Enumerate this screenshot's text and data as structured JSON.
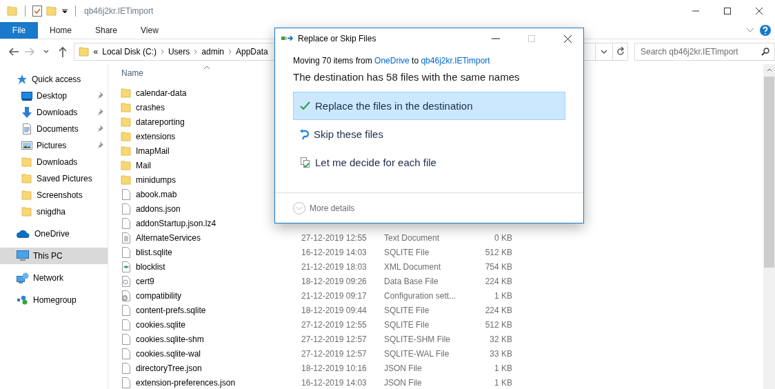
{
  "window": {
    "title": "qb46j2kr.IETimport"
  },
  "ribbon_tabs": [
    {
      "label": "File",
      "kind": "file"
    },
    {
      "label": "Home",
      "kind": "tab"
    },
    {
      "label": "Share",
      "kind": "tab"
    },
    {
      "label": "View",
      "kind": "tab"
    }
  ],
  "address_bar": {
    "overflow": "«",
    "segments": [
      "Local Disk (C:)",
      "Users",
      "admin",
      "AppData"
    ]
  },
  "search": {
    "placeholder": "Search qb46j2kr.IETimport"
  },
  "navigation": [
    {
      "label": "Quick access",
      "kind": "star",
      "selected": false,
      "children": [
        {
          "label": "Desktop",
          "kind": "desktop",
          "pinned": true,
          "selected": false
        },
        {
          "label": "Downloads",
          "kind": "download",
          "pinned": true,
          "selected": false
        },
        {
          "label": "Documents",
          "kind": "document",
          "pinned": true,
          "selected": false
        },
        {
          "label": "Pictures",
          "kind": "pictures",
          "pinned": true,
          "selected": false
        },
        {
          "label": "Downloads",
          "kind": "folder",
          "pinned": false,
          "selected": false
        },
        {
          "label": "Saved Pictures",
          "kind": "folder",
          "pinned": false,
          "selected": false
        },
        {
          "label": "Screenshots",
          "kind": "folder",
          "pinned": false,
          "selected": false
        },
        {
          "label": "snigdha",
          "kind": "folder",
          "pinned": false,
          "selected": false
        }
      ]
    },
    {
      "label": "OneDrive",
      "kind": "cloud",
      "selected": false
    },
    {
      "label": "This PC",
      "kind": "pc",
      "selected": true
    },
    {
      "label": "Network",
      "kind": "network",
      "selected": false
    },
    {
      "label": "Homegroup",
      "kind": "homegroup",
      "selected": false
    }
  ],
  "table": {
    "columns": [
      "Name"
    ],
    "rows": [
      {
        "name": "calendar-data",
        "kind": "folder"
      },
      {
        "name": "crashes",
        "kind": "folder"
      },
      {
        "name": "datareporting",
        "kind": "folder"
      },
      {
        "name": "extensions",
        "kind": "folder"
      },
      {
        "name": "ImapMail",
        "kind": "folder"
      },
      {
        "name": "Mail",
        "kind": "folder"
      },
      {
        "name": "minidumps",
        "kind": "folder"
      },
      {
        "name": "abook.mab",
        "kind": "file"
      },
      {
        "name": "addons.json",
        "kind": "file"
      },
      {
        "name": "addonStartup.json.lz4",
        "kind": "file"
      },
      {
        "name": "AlternateServices",
        "kind": "text",
        "date": "27-12-2019 12:55",
        "type": "Text Document",
        "size": "0 KB"
      },
      {
        "name": "blist.sqlite",
        "kind": "file",
        "date": "16-12-2019 14:03",
        "type": "SQLITE File",
        "size": "512 KB"
      },
      {
        "name": "blocklist",
        "kind": "xml",
        "date": "21-12-2019 18:03",
        "type": "XML Document",
        "size": "754 KB"
      },
      {
        "name": "cert9",
        "kind": "cert",
        "date": "18-12-2019 09:26",
        "type": "Data Base File",
        "size": "224 KB"
      },
      {
        "name": "compatibility",
        "kind": "settings",
        "date": "21-12-2019 09:17",
        "type": "Configuration sett...",
        "size": "1 KB"
      },
      {
        "name": "content-prefs.sqlite",
        "kind": "file",
        "date": "18-12-2019 09:44",
        "type": "SQLITE File",
        "size": "224 KB"
      },
      {
        "name": "cookies.sqlite",
        "kind": "file",
        "date": "27-12-2019 12:55",
        "type": "SQLITE File",
        "size": "512 KB"
      },
      {
        "name": "cookies.sqlite-shm",
        "kind": "file",
        "date": "27-12-2019 12:57",
        "type": "SQLITE-SHM File",
        "size": "32 KB"
      },
      {
        "name": "cookies.sqlite-wal",
        "kind": "file",
        "date": "27-12-2019 12:57",
        "type": "SQLITE-WAL File",
        "size": "33 KB"
      },
      {
        "name": "directoryTree.json",
        "kind": "file",
        "date": "18-12-2019 10:16",
        "type": "JSON File",
        "size": "1 KB"
      },
      {
        "name": "extension-preferences.json",
        "kind": "file",
        "date": "16-12-2019 14:03",
        "type": "JSON File",
        "size": "1 KB"
      }
    ]
  },
  "dialog": {
    "title": "Replace or Skip Files",
    "message": [
      {
        "text": "Moving 70 items from",
        "link": false
      },
      {
        "text": "OneDrive",
        "link": true
      },
      {
        "text": "to",
        "link": false
      },
      {
        "text": "qb46j2kr.IETimport",
        "link": true
      }
    ],
    "heading": "The destination has 58 files with the same names",
    "options": [
      {
        "label": "Replace the files in the destination",
        "kind": "replace",
        "selected": true
      },
      {
        "label": "Skip these files",
        "kind": "skip",
        "selected": false
      },
      {
        "label": "Let me decide for each file",
        "kind": "decide",
        "selected": false
      }
    ],
    "more_details": "More details"
  }
}
